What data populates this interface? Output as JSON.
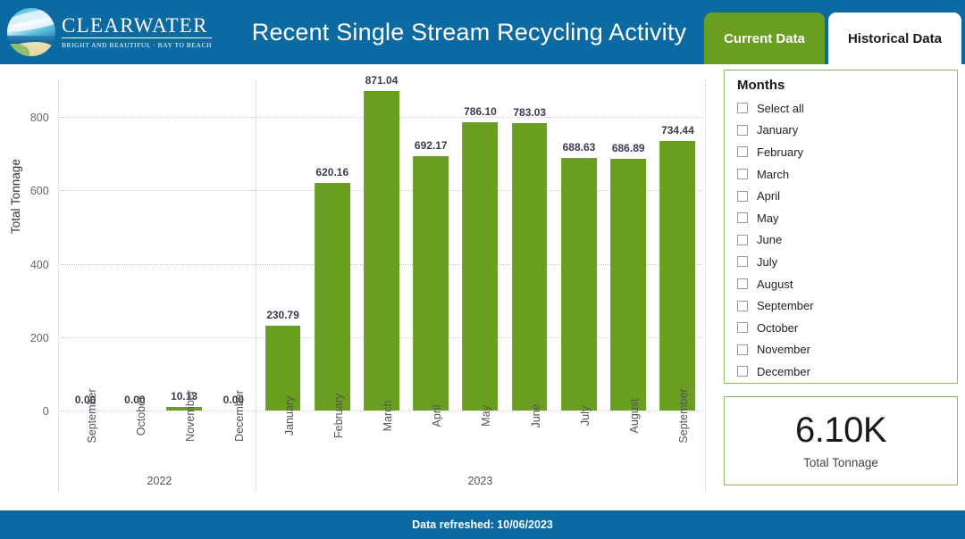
{
  "header": {
    "title": "Recent Single Stream Recycling Activity",
    "logo": {
      "name": "CLEARWATER",
      "tagline": "BRIGHT AND BEAUTIFUL · BAY TO BEACH"
    },
    "tabs": [
      {
        "label": "Current Data",
        "active": true
      },
      {
        "label": "Historical Data",
        "active": false
      }
    ],
    "bg_color": "#0a6aa1"
  },
  "chart_data": {
    "type": "bar",
    "title": "",
    "xlabel": "",
    "ylabel": "Total Tonnage",
    "ylim": [
      0,
      900
    ],
    "yticks": [
      0,
      200,
      400,
      600,
      800
    ],
    "grid": true,
    "legend": false,
    "bar_color": "#6a9e21",
    "categories": [
      "September",
      "October",
      "November",
      "December",
      "January",
      "February",
      "March",
      "April",
      "May",
      "June",
      "July",
      "August",
      "September"
    ],
    "values": [
      0.0,
      0.0,
      10.13,
      0.0,
      230.79,
      620.16,
      871.04,
      692.17,
      786.1,
      783.03,
      688.63,
      686.89,
      734.44
    ],
    "value_labels": [
      "0.00",
      "0.00",
      "10.13",
      "0.00",
      "230.79",
      "620.16",
      "871.04",
      "692.17",
      "786.10",
      "783.03",
      "688.63",
      "686.89",
      "734.44"
    ],
    "groups": [
      {
        "label": "2022",
        "start": 0,
        "count": 4
      },
      {
        "label": "2023",
        "start": 4,
        "count": 9
      }
    ]
  },
  "slicer": {
    "title": "Months",
    "items": [
      {
        "label": "Select all",
        "checked": false
      },
      {
        "label": "January",
        "checked": false
      },
      {
        "label": "February",
        "checked": false
      },
      {
        "label": "March",
        "checked": false
      },
      {
        "label": "April",
        "checked": false
      },
      {
        "label": "May",
        "checked": false
      },
      {
        "label": "June",
        "checked": false
      },
      {
        "label": "July",
        "checked": false
      },
      {
        "label": "August",
        "checked": false
      },
      {
        "label": "September",
        "checked": false
      },
      {
        "label": "October",
        "checked": false
      },
      {
        "label": "November",
        "checked": false
      },
      {
        "label": "December",
        "checked": false
      }
    ],
    "border_color": "#8fb860"
  },
  "kpi": {
    "value": "6.10K",
    "label": "Total Tonnage",
    "border_color": "#8fb860"
  },
  "footer": {
    "text": "Data refreshed: 10/06/2023"
  }
}
